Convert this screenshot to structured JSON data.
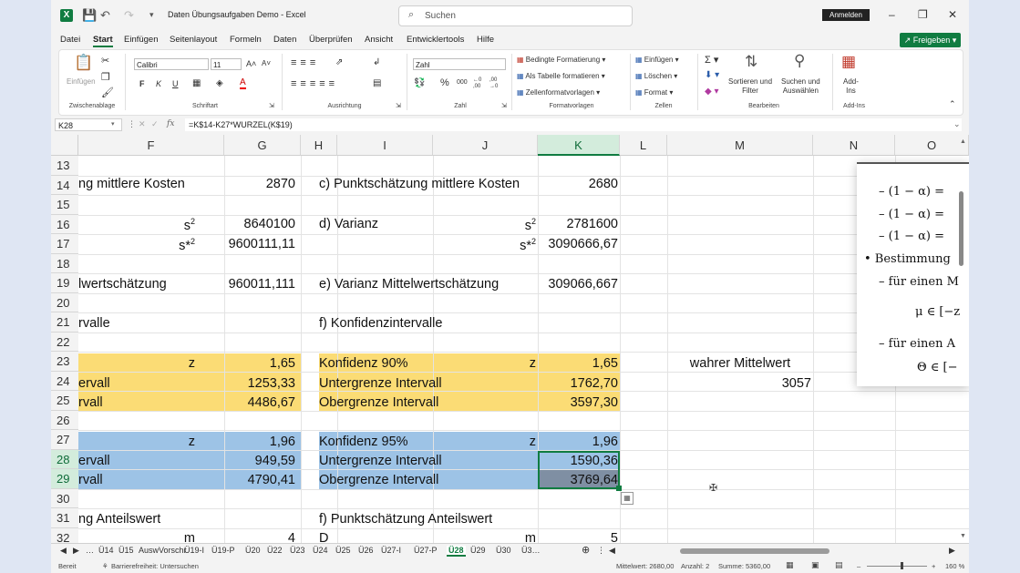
{
  "app": {
    "title": "Daten Übungsaufgaben Demo  -  Excel",
    "logo": "X",
    "search_placeholder": "Suchen",
    "signin_label": "Anmelden",
    "share_label": "Freigeben"
  },
  "menu": [
    "Datei",
    "Start",
    "Einfügen",
    "Seitenlayout",
    "Formeln",
    "Daten",
    "Überprüfen",
    "Ansicht",
    "Entwicklertools",
    "Hilfe"
  ],
  "ribbon": {
    "groups": [
      "Zwischenablage",
      "Schriftart",
      "Ausrichtung",
      "Zahl",
      "Formatvorlagen",
      "Zellen",
      "Bearbeiten",
      "Add-Ins"
    ],
    "paste_label": "Einfügen",
    "font_name": "Calibri",
    "font_size": "11",
    "number_format": "Zahl",
    "bold": "F",
    "italic": "K",
    "underline": "U",
    "grow_font": "A˄",
    "shrink_font": "A˅",
    "font_color": "A",
    "percent": "%",
    "thousands": "000",
    "dec_inc": "←0\n,00",
    "dec_dec": ",00\n→0",
    "cond_format": "Bedingte Formatierung",
    "as_table": "Als Tabelle formatieren",
    "cell_styles": "Zellenformatvorlagen",
    "insert": "Einfügen",
    "delete": "Löschen",
    "format": "Format",
    "sort_filter": "Sortieren und\nFilter",
    "find_select": "Suchen und\nAuswählen",
    "addins": "Add-\nIns"
  },
  "formula_bar": {
    "name_box": "K28",
    "fx": "fx",
    "formula": "=K$14-K27*WURZEL(K$19)"
  },
  "columns": [
    "F",
    "G",
    "H",
    "I",
    "J",
    "K",
    "L",
    "M",
    "N",
    "O"
  ],
  "rows": [
    "13",
    "14",
    "15",
    "16",
    "17",
    "18",
    "19",
    "20",
    "21",
    "22",
    "23",
    "24",
    "25",
    "26",
    "27",
    "28",
    "29",
    "30",
    "31",
    "32"
  ],
  "cells": {
    "f14": "ng mittlere Kosten",
    "g14": "2870",
    "i14": "c) Punktschätzung mittlere Kosten",
    "k14": "2680",
    "f16": "s",
    "g16": "8640100",
    "i16": "d) Varianz",
    "j16": "s",
    "k16": "2781600",
    "f17": "s*",
    "g17": "9600111,11",
    "j17": "s*",
    "k17": "3090666,67",
    "sq": "2",
    "f19": "lwertschätzung",
    "g19": "960011,111",
    "i19": "e) Varianz Mittelwertschätzung",
    "k19": "309066,667",
    "f21": "rvalle",
    "i21": "f) Konfidenzintervalle",
    "f23": "z",
    "g23": "1,65",
    "i23": "Konfidenz 90%",
    "j23": "z",
    "k23": "1,65",
    "m23": "wahrer Mittelwert",
    "f24": "ervall",
    "g24": "1253,33",
    "i24": "Untergrenze Intervall",
    "k24": "1762,70",
    "m24": "3057",
    "f25": "rvall",
    "g25": "4486,67",
    "i25": "Obergrenze Intervall",
    "k25": "3597,30",
    "f27": "z",
    "g27": "1,96",
    "i27": "Konfidenz 95%",
    "j27": "z",
    "k27": "1,96",
    "f28": "ervall",
    "g28": "949,59",
    "i28": "Untergrenze Intervall",
    "k28": "1590,36",
    "f29": "rvall",
    "g29": "4790,41",
    "i29": "Obergrenze Intervall",
    "k29": "3769,64",
    "f31": "ng Anteilswert",
    "i31": "f) Punktschätzung Anteilswert",
    "f32": "m",
    "g32": "4",
    "i32": "D",
    "j32": "m",
    "k32": "5"
  },
  "overlay": {
    "lines": [
      "– (1 − α) =",
      "– (1 − α) =",
      "– (1 − α) =",
      "• Bestimmung",
      "– für einen M",
      "μ ∈ [−z",
      "– für einen A",
      "Θ ∈ [−"
    ]
  },
  "sheet_tabs": [
    "…",
    "Ü14",
    "Ü15",
    "AuswVorschr",
    "Ü19-I",
    "Ü19-P",
    "Ü20",
    "Ü22",
    "Ü23",
    "Ü24",
    "Ü25",
    "Ü26",
    "Ü27-I",
    "Ü27-P",
    "Ü28",
    "Ü29",
    "Ü30",
    "Ü3…"
  ],
  "active_tab": "Ü28",
  "status": {
    "ready": "Bereit",
    "accessibility": "Barrierefreiheit: Untersuchen",
    "average": "Mittelwert: 2680,00",
    "count": "Anzahl: 2",
    "sum": "Summe: 5360,00",
    "zoom": "160 %"
  },
  "colors": {
    "accent": "#107c41",
    "yellow": "#fbdc75",
    "blue": "#9dc3e6",
    "selected_dark": "#7f8fa3"
  }
}
